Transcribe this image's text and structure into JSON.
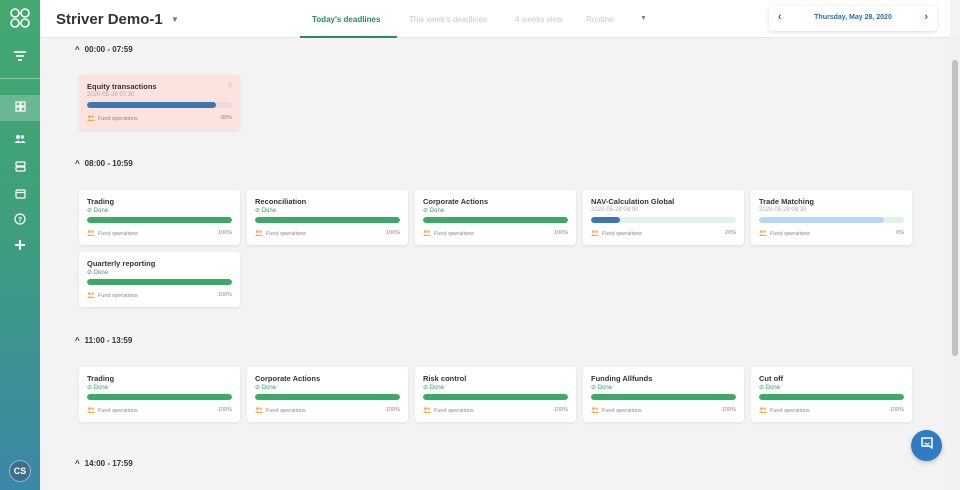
{
  "colors": {
    "accent": "#2e8b57",
    "progress_done": "#3ea86b",
    "progress_blue": "#3b78b1",
    "progress_light": "#b7d8f4",
    "overdue_bg": "#fde3df",
    "team_icon": "#f0a53a"
  },
  "header": {
    "title": "Striver Demo-1",
    "tabs": [
      "Today's deadlines",
      "This week's deadlines",
      "4 weeks view",
      "Routine"
    ],
    "date": "Thursday, May 28, 2020"
  },
  "sidebar": {
    "avatar": "CS",
    "icons": [
      "logo-icon",
      "filter-icon",
      "dashboard-icon",
      "users-icon",
      "layers-icon",
      "calendar-icon",
      "help-icon",
      "plus-icon"
    ]
  },
  "sections": [
    {
      "label": "00:00 - 07:59",
      "cards": [
        {
          "title": "Equity transactions",
          "sub": "2020-05-28 07:30",
          "team": "Fund operations",
          "pct": "89%",
          "progress": 89,
          "state": "overdue"
        }
      ]
    },
    {
      "label": "08:00 - 10:59",
      "cards": [
        {
          "title": "Trading",
          "sub": "Done",
          "team": "Fund operations",
          "pct": "100%",
          "progress": 100,
          "state": "done"
        },
        {
          "title": "Reconciliation",
          "sub": "Done",
          "team": "Fund operations",
          "pct": "100%",
          "progress": 100,
          "state": "done"
        },
        {
          "title": "Corporate Actions",
          "sub": "Done",
          "team": "Fund operations",
          "pct": "100%",
          "progress": 100,
          "state": "done"
        },
        {
          "title": "NAV-Calculation Global",
          "sub": "2020-05-28 09:00",
          "team": "Fund operations",
          "pct": "20%",
          "progress": 20,
          "state": "pending"
        },
        {
          "title": "Trade Matching",
          "sub": "2020-05-28 09:30",
          "team": "Fund operations",
          "pct": "0%",
          "progress": 0,
          "state": "pending"
        },
        {
          "title": "Quarterly reporting",
          "sub": "Done",
          "team": "Fund operations",
          "pct": "100%",
          "progress": 100,
          "state": "done"
        }
      ]
    },
    {
      "label": "11:00 - 13:59",
      "cards": [
        {
          "title": "Trading",
          "sub": "Done",
          "team": "Fund operations",
          "pct": "100%",
          "progress": 100,
          "state": "done"
        },
        {
          "title": "Corporate Actions",
          "sub": "Done",
          "team": "Fund operations",
          "pct": "100%",
          "progress": 100,
          "state": "done"
        },
        {
          "title": "Risk control",
          "sub": "Done",
          "team": "Fund operations",
          "pct": "100%",
          "progress": 100,
          "state": "done"
        },
        {
          "title": "Funding Allfunds",
          "sub": "Done",
          "team": "Fund operations",
          "pct": "100%",
          "progress": 100,
          "state": "done"
        },
        {
          "title": "Cut off",
          "sub": "Done",
          "team": "Fund operations",
          "pct": "100%",
          "progress": 100,
          "state": "done"
        }
      ]
    },
    {
      "label": "14:00 - 17:59",
      "cards": []
    }
  ]
}
